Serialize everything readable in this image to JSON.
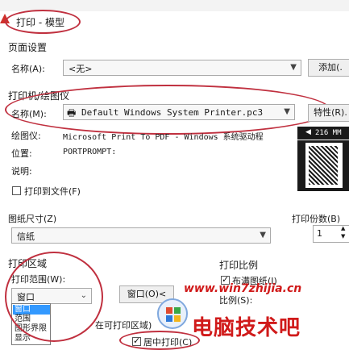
{
  "window": {
    "title": "打印 - 模型"
  },
  "page_setup": {
    "label": "页面设置",
    "name_label": "名称(A):",
    "name_value": "<无>",
    "add_button": "添加(."
  },
  "printer": {
    "label": "打印机/绘图仪",
    "name_label": "名称(M):",
    "name_value": "Default Windows System Printer.pc3",
    "properties_button": "特性(R).",
    "plotter_label": "绘图仪:",
    "plotter_value": "Microsoft Print To PDF - Windows 系统驱动程",
    "location_label": "位置:",
    "location_value": "PORTPROMPT:",
    "description_label": "说明:",
    "print_to_file_label": "打印到文件(F)",
    "preview_dim": "216 MM"
  },
  "paper": {
    "label": "图纸尺寸(Z)",
    "value": "信纸"
  },
  "copies": {
    "label": "打印份数(B)",
    "value": "1"
  },
  "plot_area": {
    "label": "打印区域",
    "range_label": "打印范围(W):",
    "range_value": "窗口",
    "window_button": "窗口(O)<",
    "options": [
      "窗口",
      "范围",
      "图形界限",
      "显示"
    ],
    "offset_hint": "在可打印区域)",
    "center_label": "居中打印(C)"
  },
  "scale": {
    "label": "打印比例",
    "fit_label": "布满图纸(I)",
    "ratio_label": "比例(S):"
  },
  "watermark": {
    "url": "www.win7zhijia.cn",
    "brand": "电脑技术吧"
  },
  "colors": {
    "accent": "#c0303f",
    "selection": "#3399ff"
  }
}
